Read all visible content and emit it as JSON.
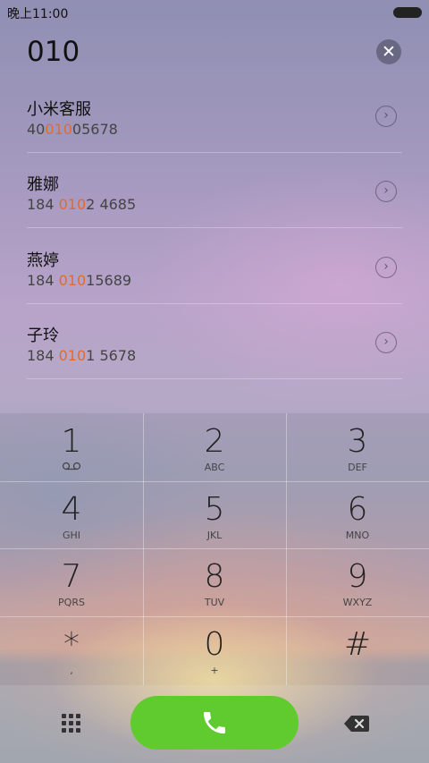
{
  "status_bar": {
    "time": "晚上11:00"
  },
  "dial_input": {
    "value": "010"
  },
  "contacts": [
    {
      "name": "小米客服",
      "num_pre": "40",
      "num_hl": "010",
      "num_post": "05678"
    },
    {
      "name": "雅娜",
      "num_pre": "184 ",
      "num_hl": "010",
      "num_post": "2 4685"
    },
    {
      "name": "燕婷",
      "num_pre": "184 ",
      "num_hl": "010",
      "num_post": "15689"
    },
    {
      "name": "子玲",
      "num_pre": "184 ",
      "num_hl": "010",
      "num_post": "1 5678"
    }
  ],
  "keypad": [
    {
      "digit": "1",
      "letters": ""
    },
    {
      "digit": "2",
      "letters": "ABC"
    },
    {
      "digit": "3",
      "letters": "DEF"
    },
    {
      "digit": "4",
      "letters": "GHI"
    },
    {
      "digit": "5",
      "letters": "JKL"
    },
    {
      "digit": "6",
      "letters": "MNO"
    },
    {
      "digit": "7",
      "letters": "PQRS"
    },
    {
      "digit": "8",
      "letters": "TUV"
    },
    {
      "digit": "9",
      "letters": "WXYZ"
    },
    {
      "digit": "*",
      "letters": ","
    },
    {
      "digit": "0",
      "letters": "+"
    },
    {
      "digit": "#",
      "letters": ""
    }
  ],
  "icons": {
    "clear": "close-icon",
    "detail": "chevron-right-circle-icon",
    "voicemail": "voicemail-icon",
    "dialpad": "dialpad-grid-icon",
    "call": "phone-icon",
    "backspace": "backspace-icon"
  },
  "colors": {
    "highlight": "#e46a2c",
    "call_button": "#5fcb2e"
  }
}
